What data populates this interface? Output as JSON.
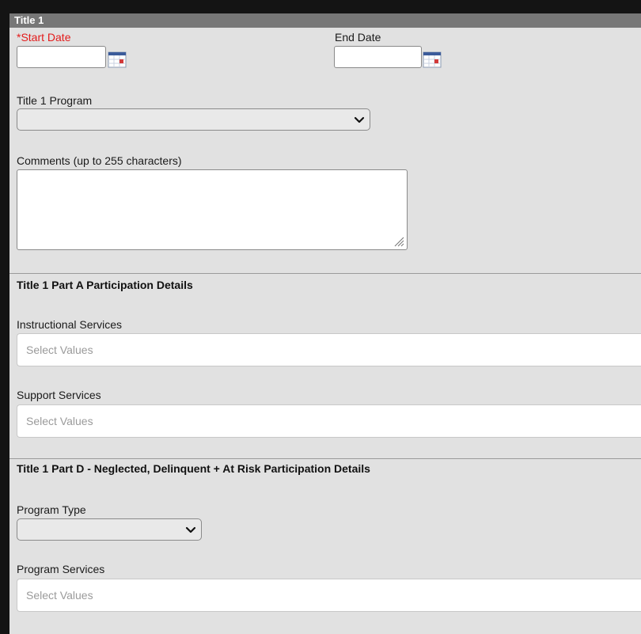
{
  "panel": {
    "title": "Title 1"
  },
  "start_date": {
    "label": "*Start Date",
    "value": "",
    "calendar_icon": "calendar-icon"
  },
  "end_date": {
    "label": "End Date",
    "value": "",
    "calendar_icon": "calendar-icon"
  },
  "program": {
    "label": "Title 1 Program",
    "selected": "",
    "icon": "chevron-down-icon"
  },
  "comments": {
    "label": "Comments (up to 255 characters)",
    "value": ""
  },
  "part_a": {
    "header": "Title 1 Part A Participation Details",
    "instructional": {
      "label": "Instructional Services",
      "placeholder": "Select Values"
    },
    "support": {
      "label": "Support Services",
      "placeholder": "Select Values"
    }
  },
  "part_d": {
    "header": "Title 1 Part D - Neglected, Delinquent + At Risk Participation Details",
    "program_type": {
      "label": "Program Type",
      "selected": "",
      "icon": "chevron-down-icon"
    },
    "program_services": {
      "label": "Program Services",
      "placeholder": "Select Values"
    }
  },
  "colors": {
    "required": "#e31b1b",
    "title_bar": "#777777",
    "panel_background": "#e1e1e1"
  }
}
